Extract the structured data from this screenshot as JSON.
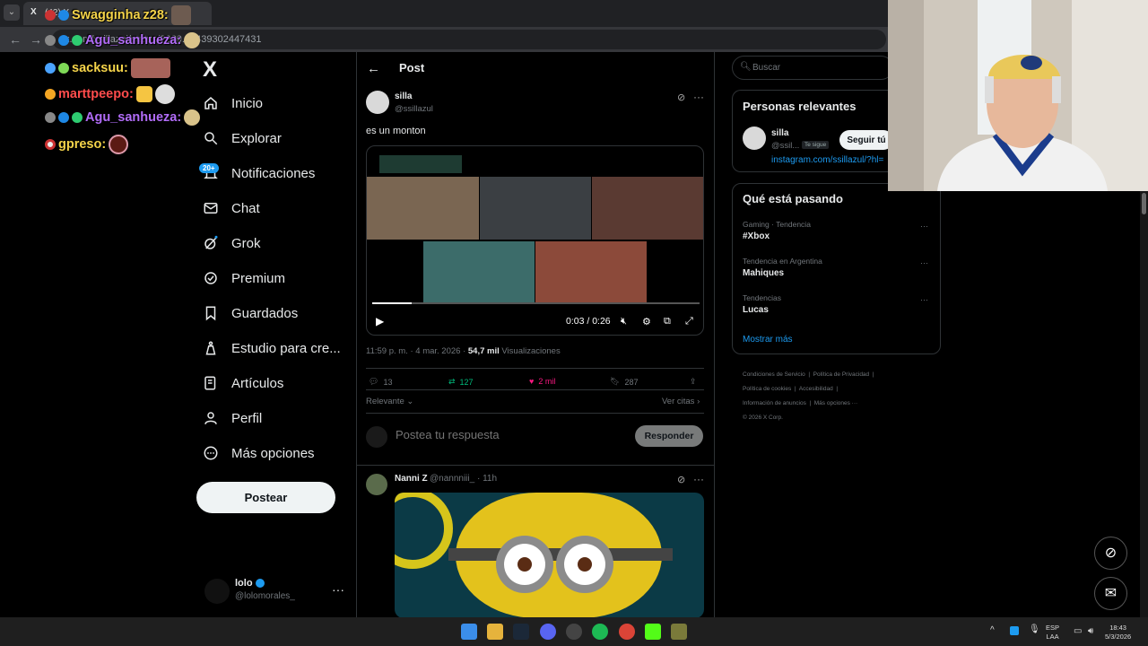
{
  "browser": {
    "tab_title": "(42) X",
    "url": "x.com/ssillazul/status/2029...1439302447431"
  },
  "stream_chat": [
    {
      "user": "Swagginha",
      "suffix": "z28:",
      "color": "#f5d44a"
    },
    {
      "user": "Agu_sanhueza:",
      "color": "#b16cf7"
    },
    {
      "user": "sacksuu:",
      "color": "#f5d44a"
    },
    {
      "user": "marttpeepo:",
      "color": "#ff4c4c"
    },
    {
      "user": "Agu_sanhueza:",
      "color": "#b16cf7"
    },
    {
      "user": "gpreso:",
      "color": "#f5d44a"
    }
  ],
  "sidebar": {
    "logo": "X",
    "items": [
      {
        "label": "Inicio",
        "icon": "home-icon"
      },
      {
        "label": "Explorar",
        "icon": "search-icon"
      },
      {
        "label": "Notificaciones",
        "icon": "bell-icon"
      },
      {
        "label": "Chat",
        "icon": "mail-icon"
      },
      {
        "label": "Grok",
        "icon": "grok-icon"
      },
      {
        "label": "Premium",
        "icon": "verified-icon"
      },
      {
        "label": "Guardados",
        "icon": "bookmark-icon"
      },
      {
        "label": "Estudio para cre...",
        "icon": "studio-icon"
      },
      {
        "label": "Artículos",
        "icon": "article-icon"
      },
      {
        "label": "Perfil",
        "icon": "person-icon"
      },
      {
        "label": "Más opciones",
        "icon": "more-circle-icon"
      }
    ],
    "notif_badge": "20+",
    "post_button": "Postear",
    "account": {
      "name": "lolo",
      "handle": "@lolomorales_"
    }
  },
  "main": {
    "header": "Post",
    "post": {
      "author": "silla",
      "handle": "@ssillazul",
      "text": "es un monton",
      "video": {
        "time": "0:03 / 0:26",
        "progress": 0.12
      },
      "timestamp": "11:59 p. m. · 4 mar. 2026 ·",
      "views_count": "54,7 mil",
      "views_label": "Visualizaciones",
      "replies": "13",
      "reposts": "127",
      "likes": "2 mil",
      "bookmarks": "287"
    },
    "sort_label": "Relevante",
    "quotes_label": "Ver citas",
    "reply_placeholder": "Postea tu respuesta",
    "reply_button": "Responder",
    "reply": {
      "author": "Nanni Z",
      "handle": "@nannniii_ · 11h"
    }
  },
  "right": {
    "search_placeholder": "Buscar",
    "relevant": {
      "title": "Personas relevantes",
      "name": "silla",
      "handle": "@ssil...",
      "follows_you": "Te sigue",
      "follow_button": "Seguir tú",
      "bio_link": "instagram.com/ssillazul/?hl="
    },
    "trends": {
      "title": "Qué está pasando",
      "items": [
        {
          "category": "Gaming · Tendencia",
          "name": "#Xbox"
        },
        {
          "category": "Tendencia en Argentina",
          "name": "Mahiques"
        },
        {
          "category": "Tendencias",
          "name": "Lucas"
        }
      ],
      "show_more": "Mostrar más"
    },
    "footer": {
      "links": [
        "Condiciones de Servicio",
        "Política de Privacidad",
        "Política de cookies",
        "Accesibilidad",
        "Información de anuncios",
        "Más opciones ···"
      ],
      "copyright": "© 2026 X Corp."
    }
  },
  "taskbar": {
    "lang": "ESP",
    "lang2": "LAA",
    "time": "18:43",
    "date": "5/3/2026"
  },
  "colors": {
    "accent": "#1d9bf0",
    "like": "#f91880",
    "repost": "#00ba7c"
  }
}
